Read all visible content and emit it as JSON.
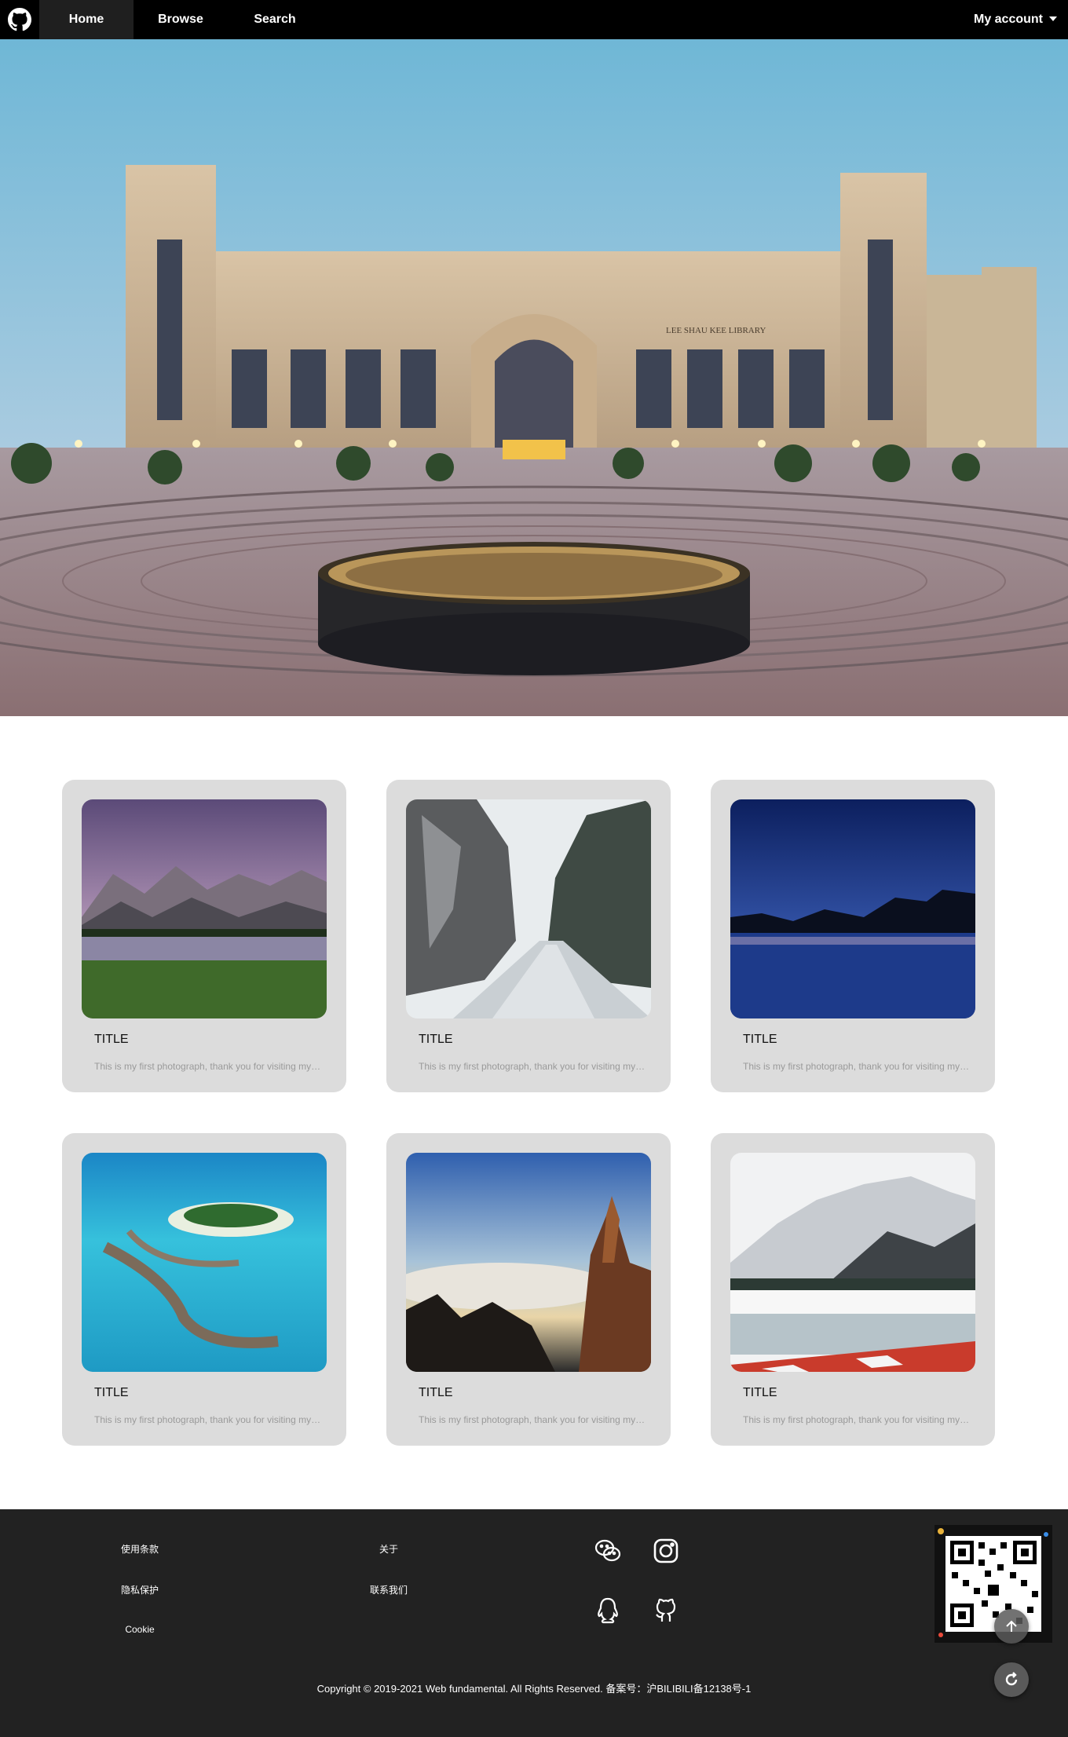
{
  "nav": {
    "logo_icon": "github-icon",
    "tabs": [
      {
        "label": "Home",
        "active": true
      },
      {
        "label": "Browse",
        "active": false
      },
      {
        "label": "Search",
        "active": false
      }
    ],
    "account_label": "My account"
  },
  "hero": {
    "image": "library-building-photo",
    "building_sign": "LEE SHAU KEE LIBRARY"
  },
  "cards": [
    {
      "title": "TITLE",
      "description": "This is my first photograph, thank you for visiting my website",
      "image": "mountain-lake-purple-sky"
    },
    {
      "title": "TITLE",
      "description": "This is my first photograph, thank you for visiting my website",
      "image": "snowy-canyon-road"
    },
    {
      "title": "TITLE",
      "description": "This is my first photograph, thank you for visiting my website",
      "image": "night-lake-silhouette"
    },
    {
      "title": "TITLE",
      "description": "This is my first photograph, thank you for visiting my website",
      "image": "tropical-island-resort"
    },
    {
      "title": "TITLE",
      "description": "This is my first photograph, thank you for visiting my website",
      "image": "rocky-peaks-sea-of-clouds"
    },
    {
      "title": "TITLE",
      "description": "This is my first photograph, thank you for visiting my website",
      "image": "snow-mountain-river"
    }
  ],
  "footer": {
    "links_col1": [
      "使用条款",
      "隐私保护",
      "Cookie"
    ],
    "links_col2": [
      "关于",
      "联系我们"
    ],
    "social_icons": [
      "wechat-icon",
      "instagram-icon",
      "qq-icon",
      "github-icon"
    ],
    "qr_code": "qr-code",
    "copyright": "Copyright © 2019-2021 Web fundamental. All Rights Reserved. 备案号：沪BILIBILI备12138号-1"
  },
  "floating_buttons": [
    "back-to-top-icon",
    "refresh-icon"
  ]
}
